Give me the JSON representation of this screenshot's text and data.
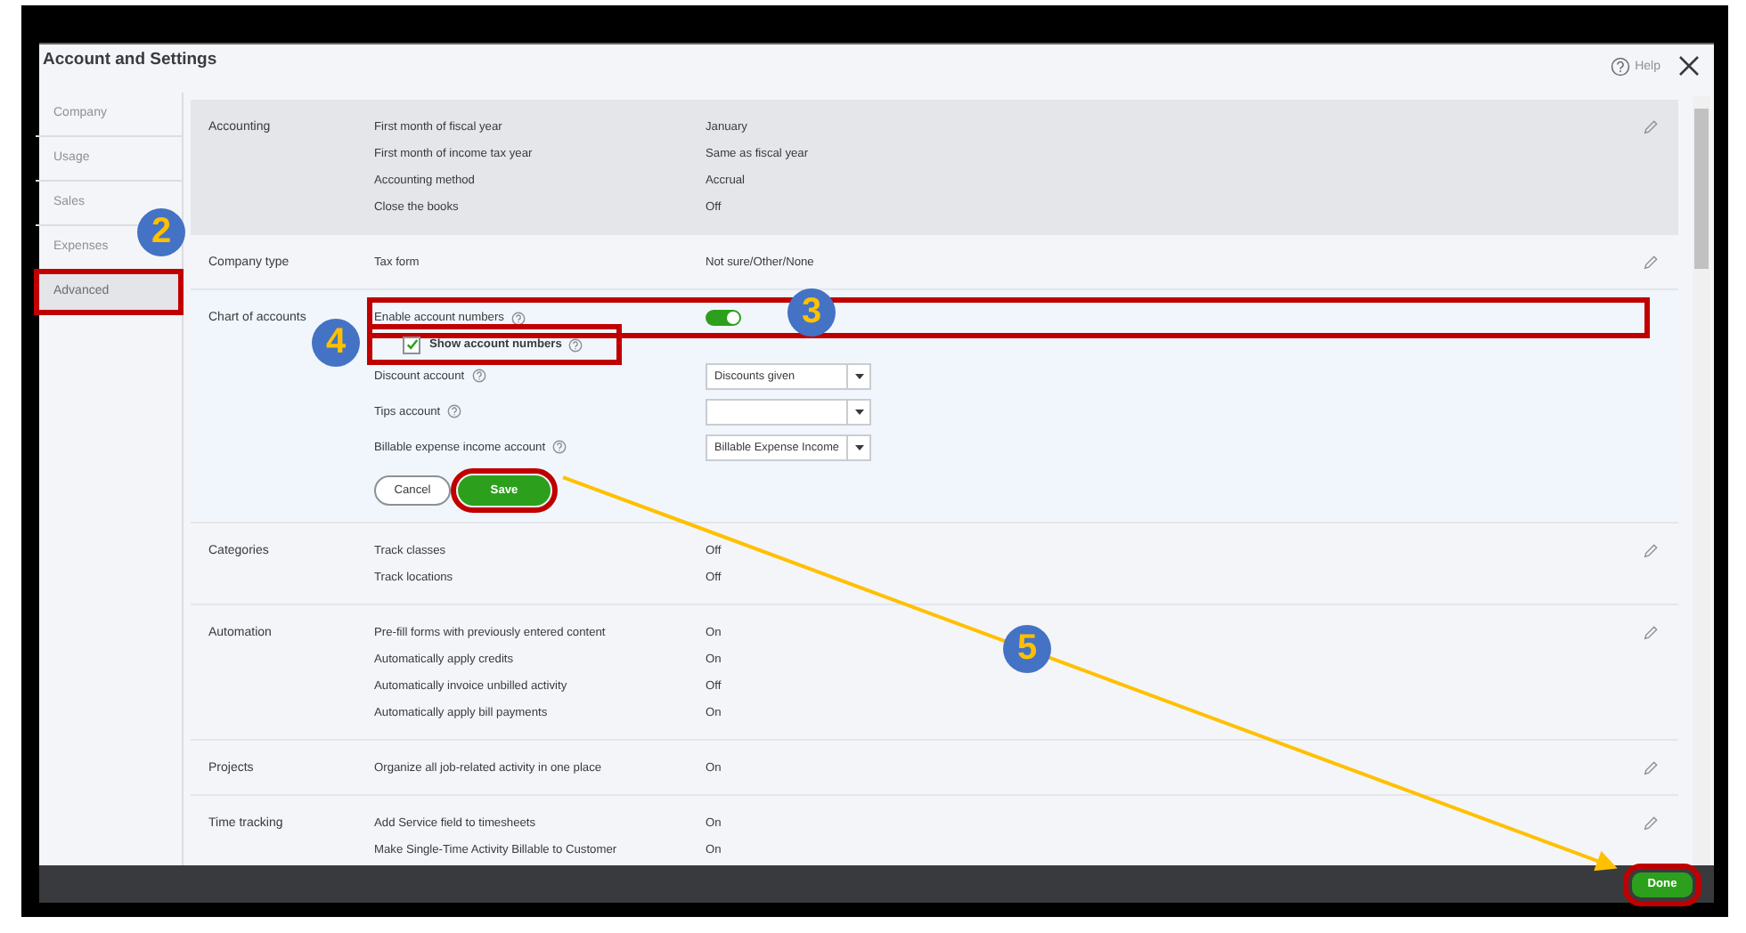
{
  "window": {
    "title": "Account and Settings",
    "help": "Help"
  },
  "sidebar": {
    "items": [
      {
        "label": "Company",
        "selected": false,
        "highlighted": false
      },
      {
        "label": "Usage",
        "selected": false,
        "highlighted": false
      },
      {
        "label": "Sales",
        "selected": false,
        "highlighted": false
      },
      {
        "label": "Expenses",
        "selected": false,
        "highlighted": false
      },
      {
        "label": "Advanced",
        "selected": true,
        "highlighted": true
      }
    ]
  },
  "sections": [
    {
      "title": "Accounting",
      "shaded": true,
      "editing": false,
      "rows": [
        {
          "kind": "setting",
          "label": "First month of fiscal year",
          "value": "January"
        },
        {
          "kind": "setting",
          "label": "First month of income tax year",
          "value": "Same as fiscal year"
        },
        {
          "kind": "setting",
          "label": "Accounting method",
          "value": "Accrual"
        },
        {
          "kind": "setting",
          "label": "Close the books",
          "value": "Off"
        }
      ]
    },
    {
      "title": "Company type",
      "shaded": false,
      "editing": false,
      "rows": [
        {
          "kind": "setting",
          "label": "Tax form",
          "value": "Not sure/Other/None"
        }
      ]
    },
    {
      "title": "Chart of accounts",
      "shaded": false,
      "editing": true,
      "rows": [
        {
          "kind": "toggle",
          "label": "Enable account numbers",
          "help": true,
          "on": true,
          "highlighted": true
        },
        {
          "kind": "checkbox",
          "label": "Show account numbers",
          "help": true,
          "checked": true,
          "highlighted": true
        },
        {
          "kind": "select",
          "label": "Discount account",
          "help": true,
          "value": "Discounts given"
        },
        {
          "kind": "select",
          "label": "Tips account",
          "help": true
        },
        {
          "kind": "select",
          "label": "Billable expense income account",
          "help": true,
          "value": "Billable Expense Income"
        }
      ],
      "actions": [
        {
          "label": "Cancel",
          "kind": "secondary",
          "highlighted": false
        },
        {
          "label": "Save",
          "kind": "primary",
          "highlighted": true
        }
      ]
    },
    {
      "title": "Categories",
      "shaded": false,
      "editing": false,
      "rows": [
        {
          "kind": "setting",
          "label": "Track classes",
          "value": "Off"
        },
        {
          "kind": "setting",
          "label": "Track locations",
          "value": "Off"
        }
      ]
    },
    {
      "title": "Automation",
      "shaded": false,
      "editing": false,
      "rows": [
        {
          "kind": "setting",
          "label": "Pre-fill forms with previously entered content",
          "value": "On"
        },
        {
          "kind": "setting",
          "label": "Automatically apply credits",
          "value": "On"
        },
        {
          "kind": "setting",
          "label": "Automatically invoice unbilled activity",
          "value": "Off"
        },
        {
          "kind": "setting",
          "label": "Automatically apply bill payments",
          "value": "On"
        }
      ]
    },
    {
      "title": "Projects",
      "shaded": false,
      "editing": false,
      "rows": [
        {
          "kind": "setting",
          "label": "Organize all job-related activity in one place",
          "value": "On"
        }
      ]
    },
    {
      "title": "Time tracking",
      "shaded": false,
      "editing": false,
      "rows": [
        {
          "kind": "setting",
          "label": "Add Service field to timesheets",
          "value": "On"
        },
        {
          "kind": "setting",
          "label": "Make Single-Time Activity Billable to Customer",
          "value": "On"
        }
      ]
    }
  ],
  "footer": {
    "done": {
      "label": "Done",
      "highlighted": true
    }
  },
  "annotations": {
    "callouts": [
      "2",
      "3",
      "4",
      "5"
    ]
  }
}
